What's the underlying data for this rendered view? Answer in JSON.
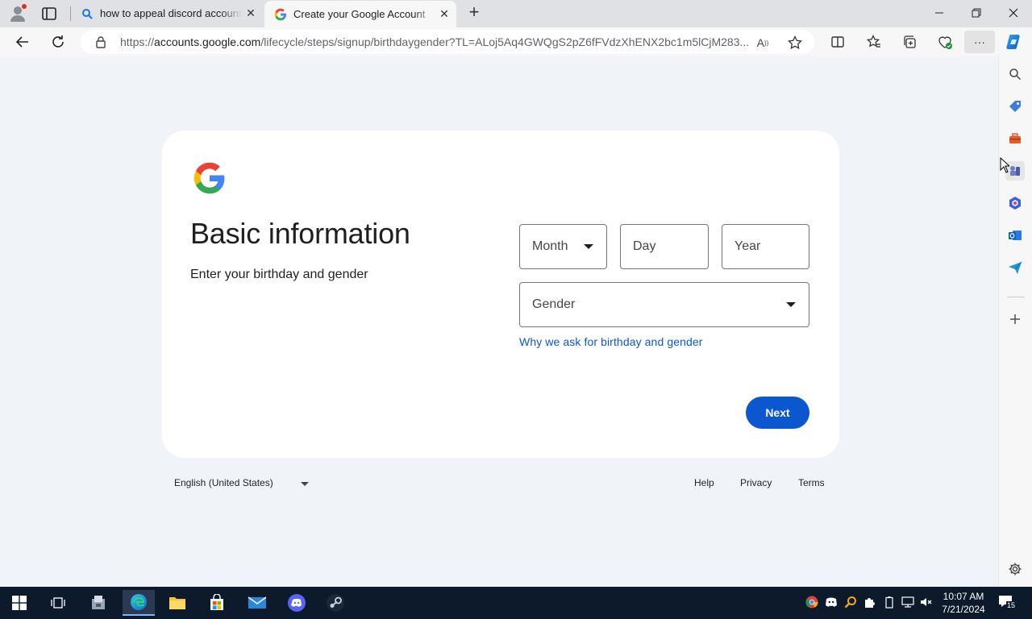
{
  "browser": {
    "tabs": [
      {
        "title": "how to appeal discord account d",
        "favicon": "search-icon",
        "close": "✕"
      },
      {
        "title": "Create your Google Account",
        "favicon": "google-icon",
        "close": "✕"
      }
    ],
    "new_tab": "+",
    "window_controls": {
      "minimize": "—",
      "restore": "❐",
      "close": "✕"
    },
    "url": {
      "prefix": "https://",
      "host": "accounts.google.com",
      "path": "/lifecycle/steps/signup/birthdaygender?TL=ALoj5Aq4GWQgS2pZ6fFVdzXhENX2bc1m5lCjM283..."
    },
    "toolbar_more": "···"
  },
  "page": {
    "heading": "Basic information",
    "subheading": "Enter your birthday and gender",
    "month_placeholder": "Month",
    "day_placeholder": "Day",
    "year_placeholder": "Year",
    "gender_placeholder": "Gender",
    "why_link": "Why we ask for birthday and gender",
    "next_button": "Next"
  },
  "footer": {
    "language": "English (United States)",
    "help": "Help",
    "privacy": "Privacy",
    "terms": "Terms"
  },
  "taskbar": {
    "time": "10:07 AM",
    "date": "7/21/2024",
    "notifications": "15"
  },
  "colors": {
    "accent": "#0b57d0",
    "page_bg": "#f0f4f9",
    "taskbar_bg": "#0c1a2c"
  }
}
